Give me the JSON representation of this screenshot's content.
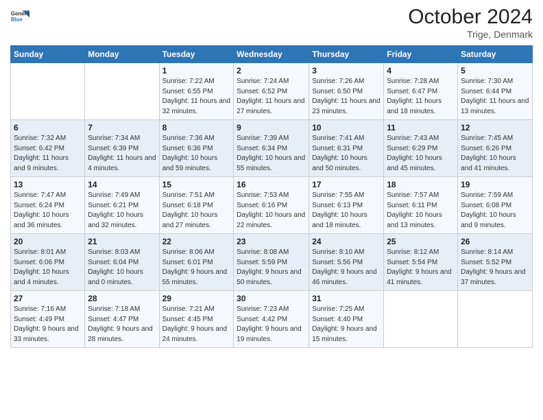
{
  "header": {
    "logo_line1": "General",
    "logo_line2": "Blue",
    "month": "October 2024",
    "location": "Trige, Denmark"
  },
  "columns": [
    "Sunday",
    "Monday",
    "Tuesday",
    "Wednesday",
    "Thursday",
    "Friday",
    "Saturday"
  ],
  "weeks": [
    [
      {
        "day": "",
        "detail": ""
      },
      {
        "day": "",
        "detail": ""
      },
      {
        "day": "1",
        "detail": "Sunrise: 7:22 AM\nSunset: 6:55 PM\nDaylight: 11 hours and 32 minutes."
      },
      {
        "day": "2",
        "detail": "Sunrise: 7:24 AM\nSunset: 6:52 PM\nDaylight: 11 hours and 27 minutes."
      },
      {
        "day": "3",
        "detail": "Sunrise: 7:26 AM\nSunset: 6:50 PM\nDaylight: 11 hours and 23 minutes."
      },
      {
        "day": "4",
        "detail": "Sunrise: 7:28 AM\nSunset: 6:47 PM\nDaylight: 11 hours and 18 minutes."
      },
      {
        "day": "5",
        "detail": "Sunrise: 7:30 AM\nSunset: 6:44 PM\nDaylight: 11 hours and 13 minutes."
      }
    ],
    [
      {
        "day": "6",
        "detail": "Sunrise: 7:32 AM\nSunset: 6:42 PM\nDaylight: 11 hours and 9 minutes."
      },
      {
        "day": "7",
        "detail": "Sunrise: 7:34 AM\nSunset: 6:39 PM\nDaylight: 11 hours and 4 minutes."
      },
      {
        "day": "8",
        "detail": "Sunrise: 7:36 AM\nSunset: 6:36 PM\nDaylight: 10 hours and 59 minutes."
      },
      {
        "day": "9",
        "detail": "Sunrise: 7:39 AM\nSunset: 6:34 PM\nDaylight: 10 hours and 55 minutes."
      },
      {
        "day": "10",
        "detail": "Sunrise: 7:41 AM\nSunset: 6:31 PM\nDaylight: 10 hours and 50 minutes."
      },
      {
        "day": "11",
        "detail": "Sunrise: 7:43 AM\nSunset: 6:29 PM\nDaylight: 10 hours and 45 minutes."
      },
      {
        "day": "12",
        "detail": "Sunrise: 7:45 AM\nSunset: 6:26 PM\nDaylight: 10 hours and 41 minutes."
      }
    ],
    [
      {
        "day": "13",
        "detail": "Sunrise: 7:47 AM\nSunset: 6:24 PM\nDaylight: 10 hours and 36 minutes."
      },
      {
        "day": "14",
        "detail": "Sunrise: 7:49 AM\nSunset: 6:21 PM\nDaylight: 10 hours and 32 minutes."
      },
      {
        "day": "15",
        "detail": "Sunrise: 7:51 AM\nSunset: 6:18 PM\nDaylight: 10 hours and 27 minutes."
      },
      {
        "day": "16",
        "detail": "Sunrise: 7:53 AM\nSunset: 6:16 PM\nDaylight: 10 hours and 22 minutes."
      },
      {
        "day": "17",
        "detail": "Sunrise: 7:55 AM\nSunset: 6:13 PM\nDaylight: 10 hours and 18 minutes."
      },
      {
        "day": "18",
        "detail": "Sunrise: 7:57 AM\nSunset: 6:11 PM\nDaylight: 10 hours and 13 minutes."
      },
      {
        "day": "19",
        "detail": "Sunrise: 7:59 AM\nSunset: 6:08 PM\nDaylight: 10 hours and 9 minutes."
      }
    ],
    [
      {
        "day": "20",
        "detail": "Sunrise: 8:01 AM\nSunset: 6:06 PM\nDaylight: 10 hours and 4 minutes."
      },
      {
        "day": "21",
        "detail": "Sunrise: 8:03 AM\nSunset: 6:04 PM\nDaylight: 10 hours and 0 minutes."
      },
      {
        "day": "22",
        "detail": "Sunrise: 8:06 AM\nSunset: 6:01 PM\nDaylight: 9 hours and 55 minutes."
      },
      {
        "day": "23",
        "detail": "Sunrise: 8:08 AM\nSunset: 5:59 PM\nDaylight: 9 hours and 50 minutes."
      },
      {
        "day": "24",
        "detail": "Sunrise: 8:10 AM\nSunset: 5:56 PM\nDaylight: 9 hours and 46 minutes."
      },
      {
        "day": "25",
        "detail": "Sunrise: 8:12 AM\nSunset: 5:54 PM\nDaylight: 9 hours and 41 minutes."
      },
      {
        "day": "26",
        "detail": "Sunrise: 8:14 AM\nSunset: 5:52 PM\nDaylight: 9 hours and 37 minutes."
      }
    ],
    [
      {
        "day": "27",
        "detail": "Sunrise: 7:16 AM\nSunset: 4:49 PM\nDaylight: 9 hours and 33 minutes."
      },
      {
        "day": "28",
        "detail": "Sunrise: 7:18 AM\nSunset: 4:47 PM\nDaylight: 9 hours and 28 minutes."
      },
      {
        "day": "29",
        "detail": "Sunrise: 7:21 AM\nSunset: 4:45 PM\nDaylight: 9 hours and 24 minutes."
      },
      {
        "day": "30",
        "detail": "Sunrise: 7:23 AM\nSunset: 4:42 PM\nDaylight: 9 hours and 19 minutes."
      },
      {
        "day": "31",
        "detail": "Sunrise: 7:25 AM\nSunset: 4:40 PM\nDaylight: 9 hours and 15 minutes."
      },
      {
        "day": "",
        "detail": ""
      },
      {
        "day": "",
        "detail": ""
      }
    ]
  ]
}
